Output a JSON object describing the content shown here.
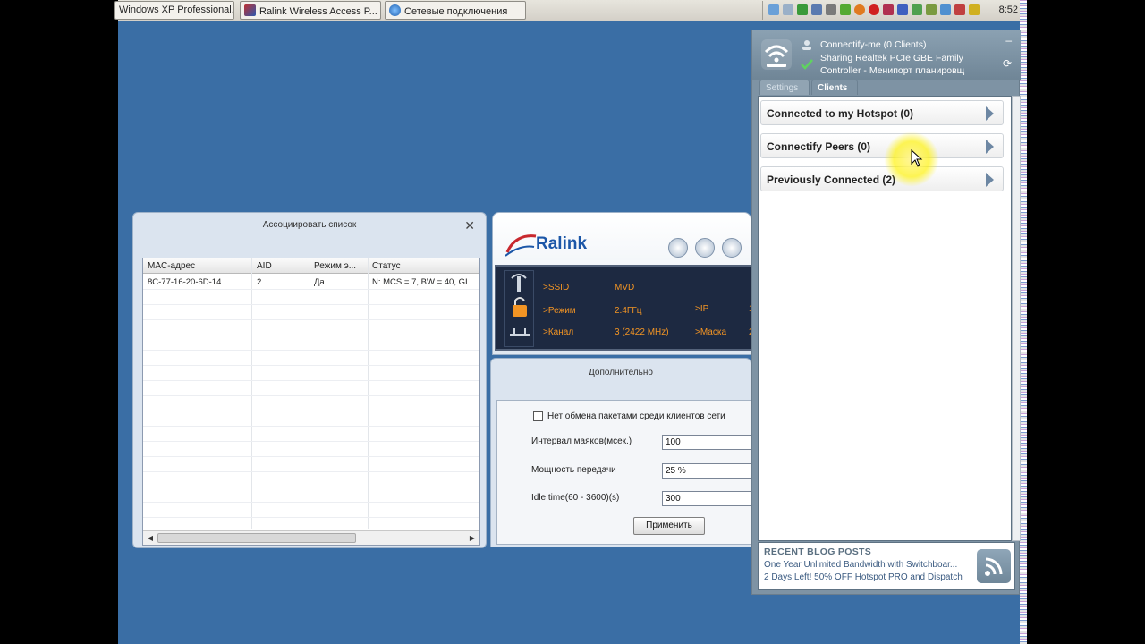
{
  "taskbar": {
    "buttons": [
      {
        "label": "Windows XP Professional..."
      },
      {
        "label": "Ralink Wireless Access P..."
      },
      {
        "label": "Сетевые подключения"
      }
    ],
    "clock": "8:52"
  },
  "assoc_window": {
    "title": "Ассоциировать список",
    "columns": [
      "MAC-адрес",
      "AID",
      "Режим э...",
      "Статус"
    ],
    "rows": [
      [
        "8C-77-16-20-6D-14",
        "2",
        "Да",
        "N: MCS = 7, BW = 40, GI"
      ]
    ]
  },
  "ralink": {
    "logo": "Ralink",
    "info": {
      "ssid_label": "SSID",
      "ssid_value": "MVD",
      "mode_label": "Режим",
      "mode_value": "2.4ГГц",
      "channel_label": "Канал",
      "channel_value": "3 (2422 MHz)",
      "ip_label": "IP",
      "ip_value": "1",
      "mask_label": "Маска",
      "mask_value": "2"
    }
  },
  "advanced": {
    "title": "Дополнительно",
    "isolation_label": "Нет обмена пакетами среди клиентов сети",
    "beacon_label": "Интервал маяков(мсек.)",
    "beacon_value": "100",
    "power_label": "Мощность передачи",
    "power_value": "25 %",
    "idle_label": "Idle time(60 - 3600)(s)",
    "idle_value": "300",
    "apply_label": "Применить"
  },
  "connectify": {
    "hotspot_line": "Connectify-me (0 Clients)",
    "sharing_line1": "Sharing Realtek PCIe GBE Family",
    "sharing_line2": "Controller - Менипорт планировщ",
    "tabs": [
      "Settings",
      "Clients"
    ],
    "active_tab": "Clients",
    "sections": [
      {
        "label": "Connected to my Hotspot (0)"
      },
      {
        "label": "Connectify Peers (0)"
      },
      {
        "label": "Previously Connected (2)"
      }
    ],
    "blog": {
      "title": "RECENT BLOG POSTS",
      "links": [
        "One Year Unlimited Bandwidth with Switchboar...",
        "2 Days Left! 50% OFF Hotspot PRO and Dispatch"
      ]
    }
  }
}
